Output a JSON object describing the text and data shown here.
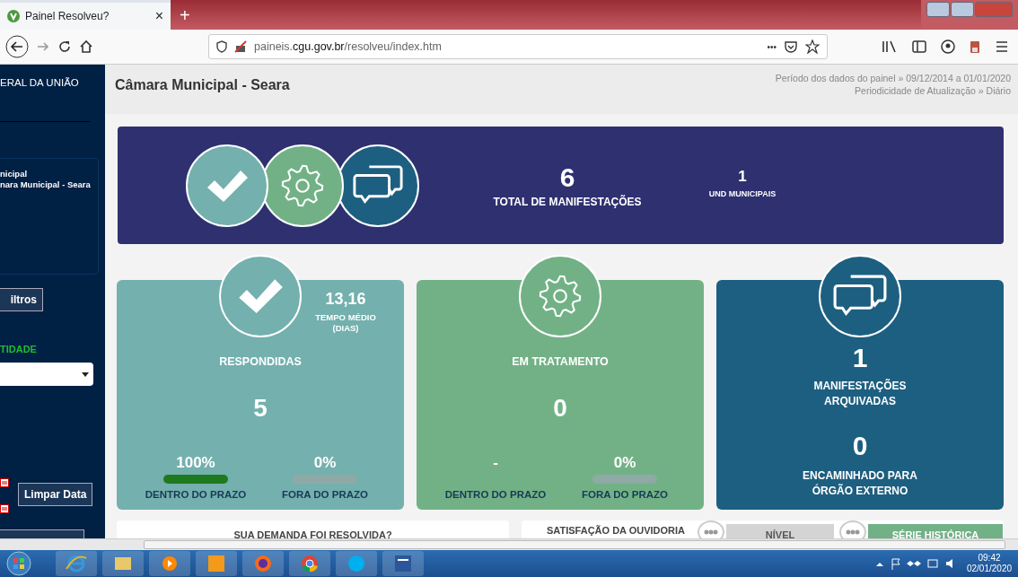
{
  "browser": {
    "tab": {
      "title": "Painel Resolveu?",
      "close": "×"
    },
    "new_tab": "+",
    "url": "paineis.**cgu.gov.br**/resolveu/index.htm",
    "url_more": "•••"
  },
  "sidebar": {
    "org": "ERAL DA UNIÃO",
    "selection": [
      "nicipal",
      "nara Municipal - Seara"
    ],
    "filters_button": "iltros",
    "entity_label": "TIDADE",
    "clear_date_button": "Limpar Data"
  },
  "header": {
    "title": "Câmara Municipal - Seara",
    "period": "Período dos dados do painel » 09/12/2014 a 01/01/2020",
    "update": "Periodicidade de Atualização » Diário"
  },
  "summary": {
    "total": {
      "value": "6",
      "label": "TOTAL DE MANIFESTAÇÕES"
    },
    "units": {
      "value": "1",
      "label": "UND MUNICIPAIS"
    }
  },
  "cards": [
    {
      "kind": "answered",
      "label": "RESPONDIDAS",
      "value": "5",
      "average": {
        "value": "13,16",
        "label": "TEMPO MÉDIO (DIAS)"
      },
      "bars": [
        {
          "value": "100%",
          "label": "DENTRO DO PRAZO",
          "level": 1
        },
        {
          "value": "0%",
          "label": "FORA DO PRAZO",
          "level": 0
        }
      ]
    },
    {
      "kind": "treatment",
      "label": "EM TRATAMENTO",
      "value": "0",
      "bars": [
        {
          "value": "-",
          "label": "DENTRO DO PRAZO"
        },
        {
          "value": "0%",
          "label": "FORA DO PRAZO",
          "level": 0
        }
      ]
    },
    {
      "kind": "archived",
      "stats": [
        {
          "value": "1",
          "label": "MANIFESTAÇÕES ARQUIVADAS"
        },
        {
          "value": "0",
          "label": "ENCAMINHADO PARA ÓRGÃO EXTERNO"
        }
      ]
    }
  ],
  "bottom": {
    "left_title": "SUA DEMANDA FOI RESOLVIDA?",
    "right_title": "SATISFAÇÃO DA OUVIDORIA",
    "tabs": [
      {
        "label": "NÍVEL",
        "selected": false
      },
      {
        "label": "SÉRIE HISTÓRICA",
        "selected": true
      }
    ]
  },
  "taskbar": {
    "time": "09:42",
    "date": "02/01/2020"
  }
}
